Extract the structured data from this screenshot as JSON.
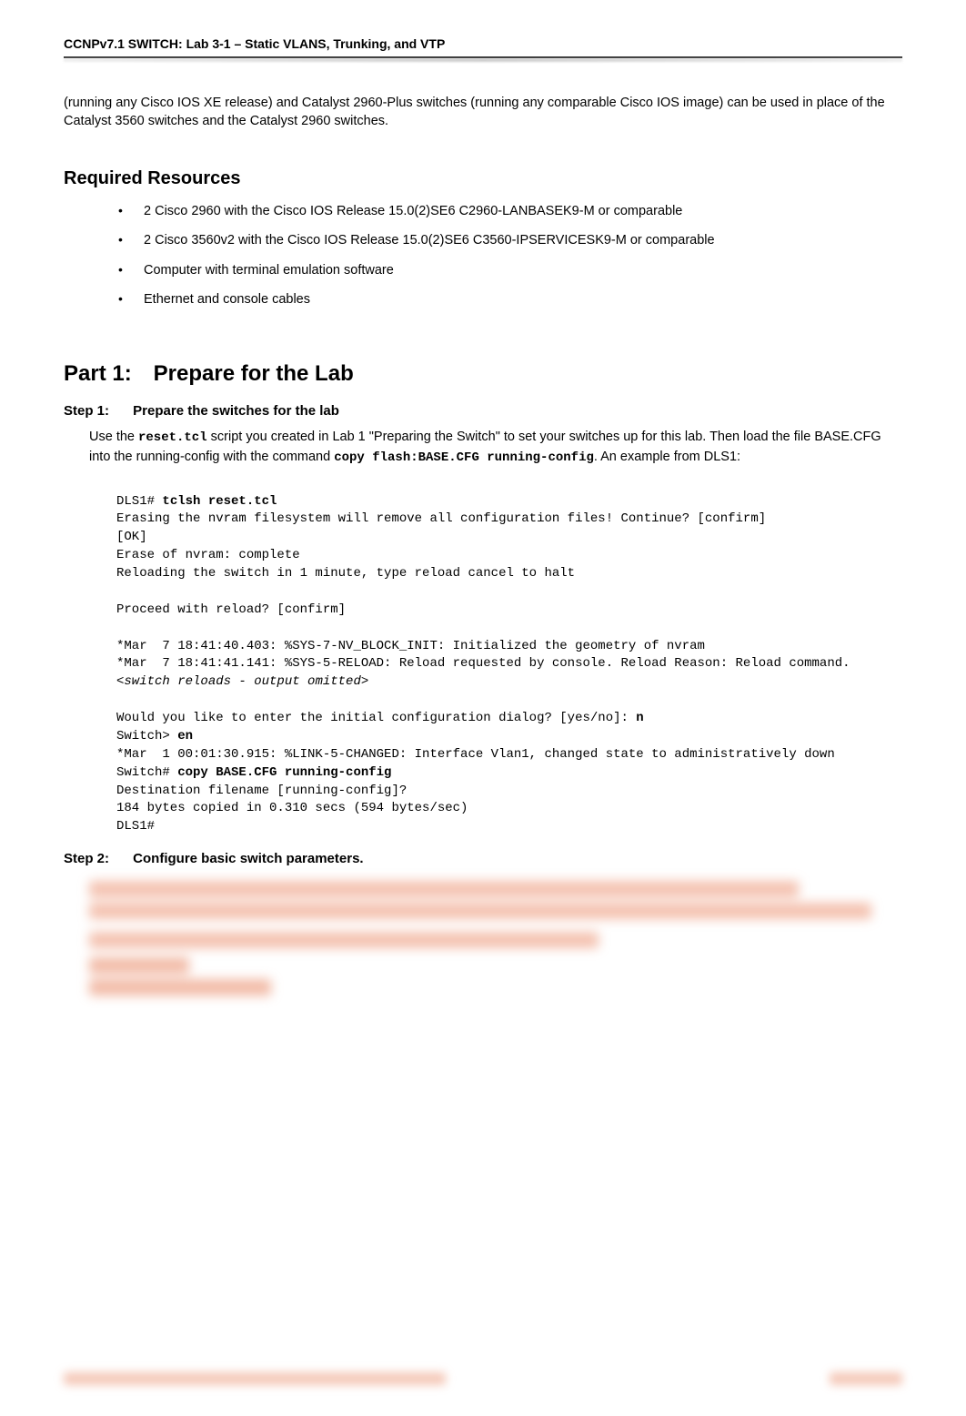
{
  "header": {
    "title": "CCNPv7.1 SWITCH: Lab 3-1 – Static VLANS, Trunking, and VTP"
  },
  "intro": "(running any Cisco IOS XE release) and Catalyst 2960-Plus switches (running any comparable Cisco IOS image) can be used in place of the Catalyst 3560 switches and the Catalyst 2960 switches.",
  "required_resources": {
    "heading": "Required Resources",
    "items": [
      "2 Cisco 2960 with the Cisco IOS Release 15.0(2)SE6 C2960-LANBASEK9-M or comparable",
      "2 Cisco 3560v2 with the Cisco IOS Release 15.0(2)SE6 C3560-IPSERVICESK9-M or comparable",
      "Computer with terminal emulation software",
      "Ethernet and console cables"
    ]
  },
  "part1": {
    "label": "Part 1:",
    "title": "Prepare for the Lab"
  },
  "step1": {
    "label": "Step 1:",
    "title": "Prepare the switches for the lab",
    "p1a": "Use the ",
    "p1b": "reset.tcl",
    "p1c": " script you created in Lab 1 \"Preparing the Switch\" to set your switches up for this lab. Then load the file BASE.CFG into the running-config with the command ",
    "p1d": "copy flash:BASE.CFG running-config",
    "p1e": ". An example from DLS1:",
    "code": {
      "l1a": "DLS1# ",
      "l1b": "tclsh reset.tcl",
      "l2": "Erasing the nvram filesystem will remove all configuration files! Continue? [confirm]",
      "l3": "[OK]",
      "l4": "Erase of nvram: complete",
      "l5": "Reloading the switch in 1 minute, type reload cancel to halt",
      "l6": "Proceed with reload? [confirm]",
      "l7": "*Mar  7 18:41:40.403: %SYS-7-NV_BLOCK_INIT: Initialized the geometry of nvram",
      "l8": "*Mar  7 18:41:41.141: %SYS-5-RELOAD: Reload requested by console. Reload Reason: Reload command.",
      "l9a": "<",
      "l9b": "switch reloads - output omitted",
      "l9c": ">",
      "l10a": "Would you like to enter the initial configuration dialog? [yes/no]: ",
      "l10b": "n",
      "l11a": "Switch> ",
      "l11b": "en",
      "l12": "*Mar  1 00:01:30.915: %LINK-5-CHANGED: Interface Vlan1, changed state to administratively down",
      "l13a": "Switch# ",
      "l13b": "copy BASE.CFG running-config",
      "l14": "Destination filename [running-config]?",
      "l15": "184 bytes copied in 0.310 secs (594 bytes/sec)",
      "l16": "DLS1#"
    }
  },
  "step2": {
    "label": "Step 2:",
    "title": "Configure basic switch parameters."
  }
}
